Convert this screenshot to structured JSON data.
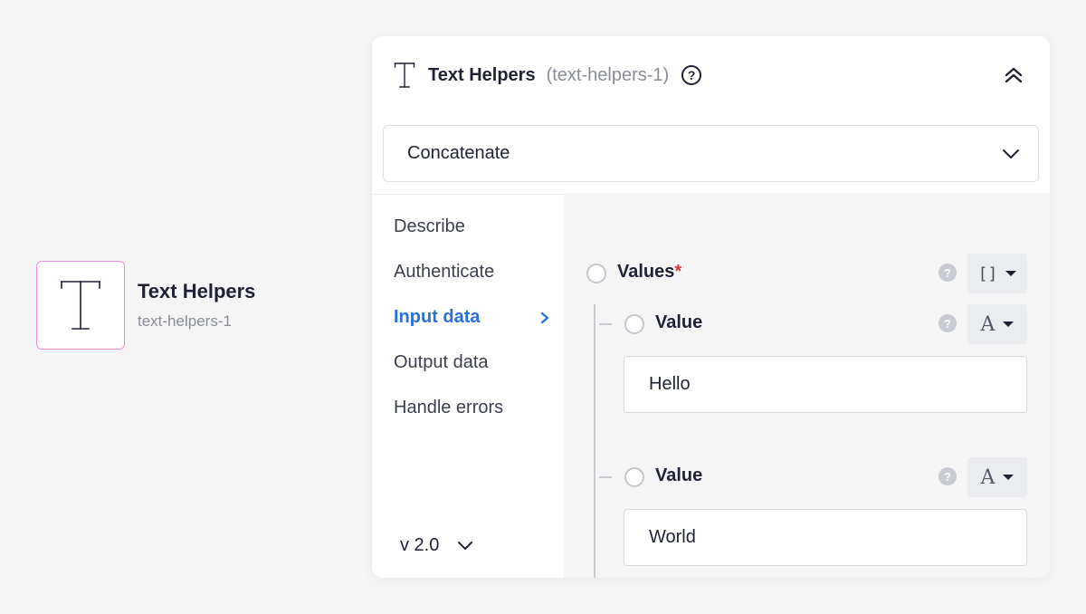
{
  "node": {
    "title": "Text Helpers",
    "subtitle": "text-helpers-1",
    "icon": "text-t-icon"
  },
  "panel": {
    "title": "Text Helpers",
    "id_label": "(text-helpers-1)",
    "help_glyph": "?",
    "action": {
      "value": "Concatenate"
    },
    "nav": [
      {
        "label": "Describe",
        "active": false
      },
      {
        "label": "Authenticate",
        "active": false
      },
      {
        "label": "Input data",
        "active": true
      },
      {
        "label": "Output data",
        "active": false
      },
      {
        "label": "Handle errors",
        "active": false
      }
    ],
    "version": "v 2.0",
    "fields": {
      "values": {
        "label": "Values",
        "required_mark": "*",
        "type_symbol": "[]",
        "help_glyph": "?"
      },
      "items": [
        {
          "label": "Value",
          "type_symbol": "A",
          "help_glyph": "?",
          "value": "Hello"
        },
        {
          "label": "Value",
          "type_symbol": "A",
          "help_glyph": "?",
          "value": "World"
        }
      ]
    }
  },
  "colors": {
    "accent": "#2a6fdb",
    "node_border": "#ee8fd9",
    "required": "#d63b3b",
    "background": "#f5f5f6"
  }
}
